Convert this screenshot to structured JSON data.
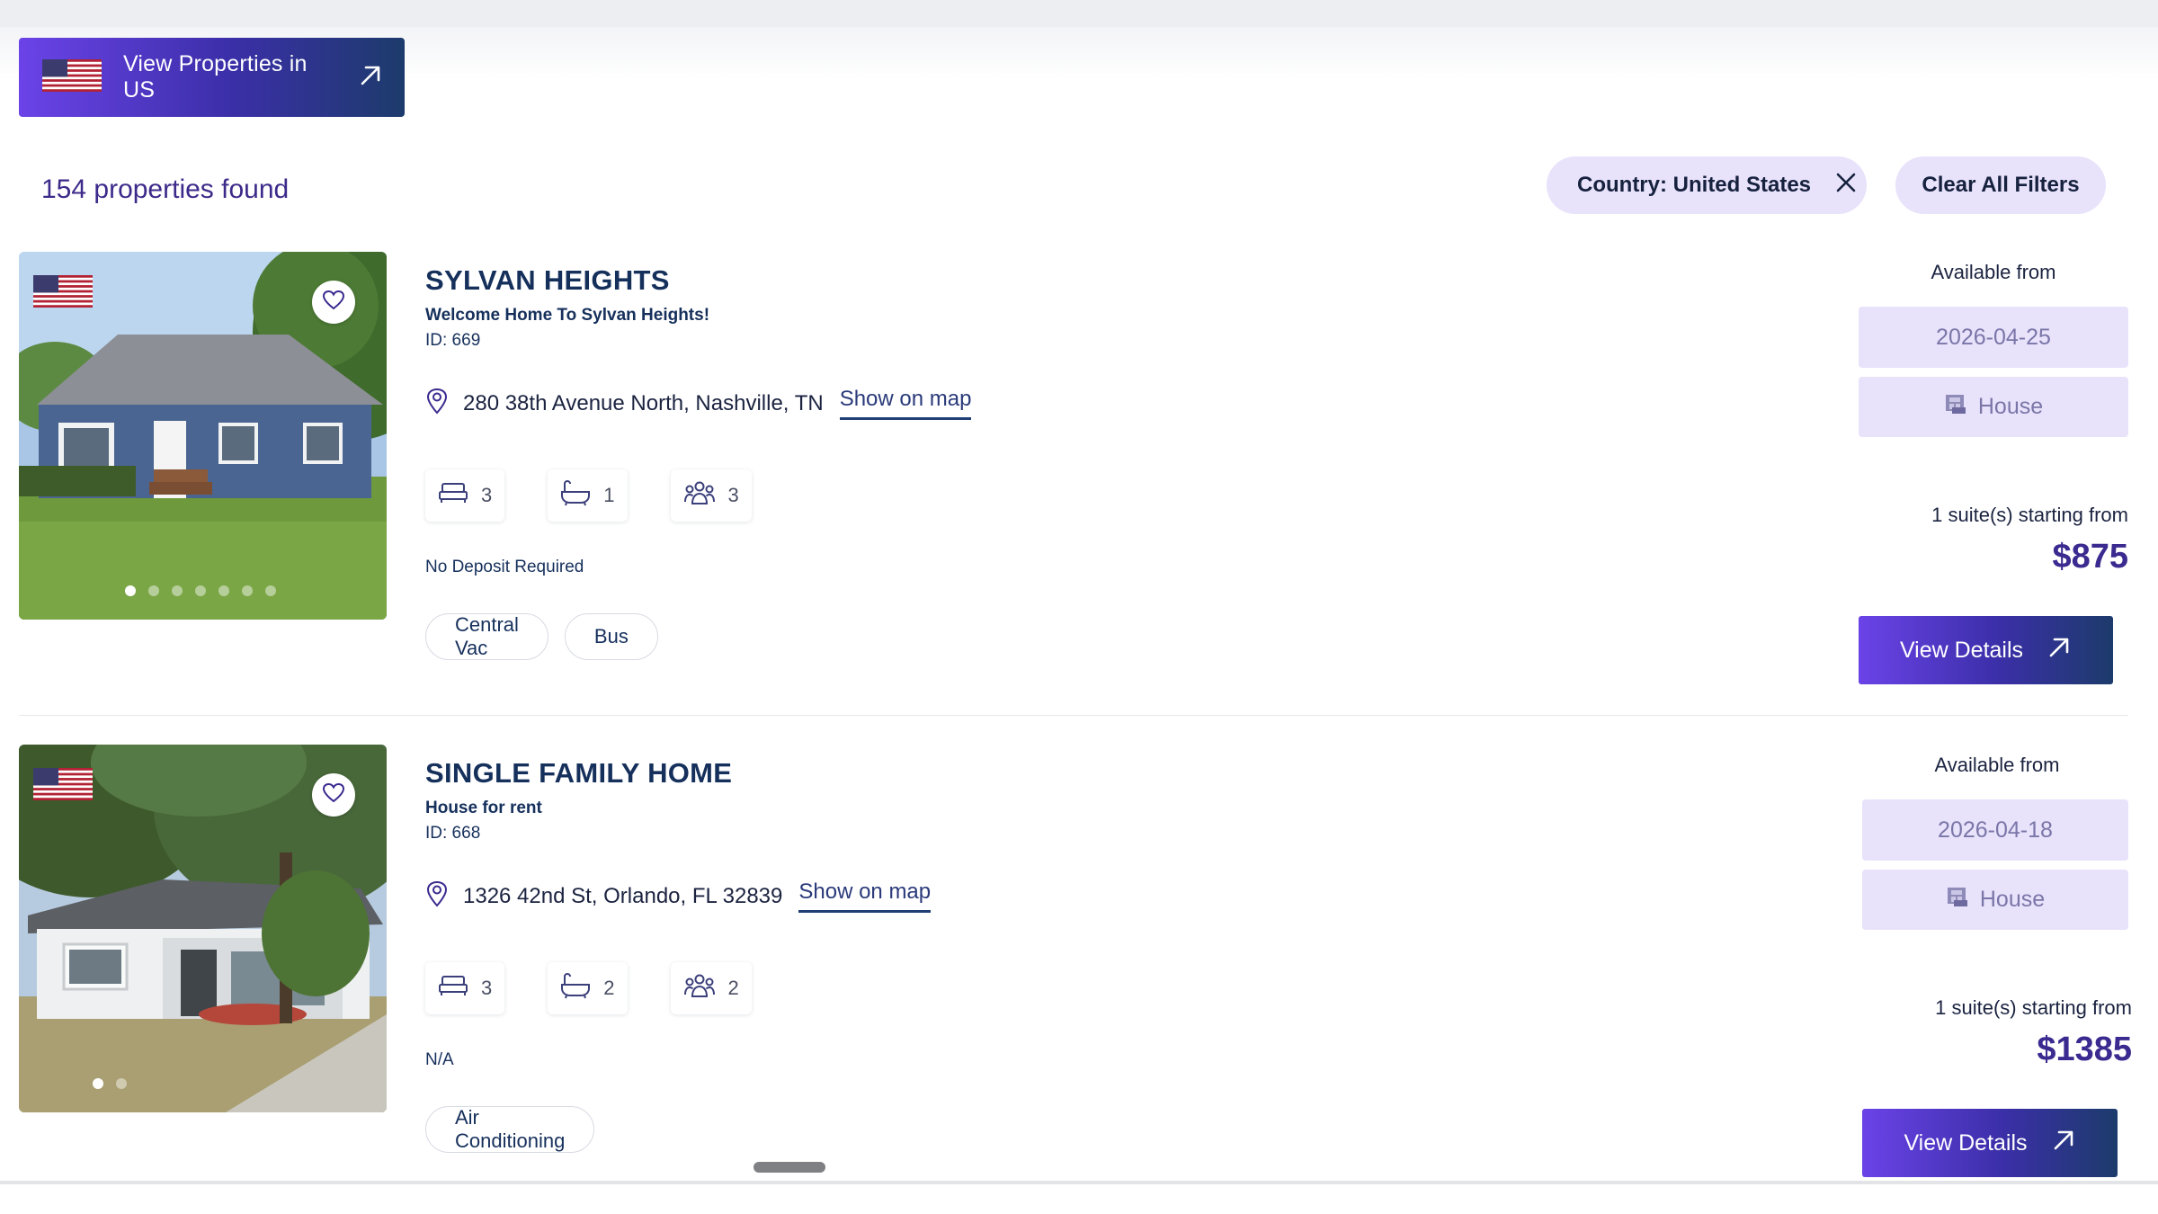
{
  "header": {
    "view_us_label": "View Properties in US"
  },
  "results": {
    "count_text": "154 properties found"
  },
  "filters": {
    "country_chip": "Country: United States",
    "clear_all": "Clear All Filters"
  },
  "listings": [
    {
      "title": "SYLVAN HEIGHTS",
      "subtitle": "Welcome Home To Sylvan Heights!",
      "id_text": "ID: 669",
      "address": "280 38th Avenue North, Nashville, TN",
      "show_on_map": "Show on map",
      "beds": "3",
      "baths": "1",
      "occupants": "3",
      "note": "No Deposit Required",
      "tags": [
        "Central Vac",
        "Bus"
      ],
      "available_label": "Available from",
      "available_date": "2026-04-25",
      "type": "House",
      "suites_text": "1 suite(s) starting from",
      "price": "$875",
      "details_label": "View Details",
      "photo_dots": 7,
      "active_dot": 0
    },
    {
      "title": "SINGLE FAMILY HOME",
      "subtitle": "House for rent",
      "id_text": "ID: 668",
      "address": "1326 42nd St, Orlando, FL 32839",
      "show_on_map": "Show on map",
      "beds": "3",
      "baths": "2",
      "occupants": "2",
      "note": "N/A",
      "tags": [
        "Air Conditioning"
      ],
      "available_label": "Available from",
      "available_date": "2026-04-18",
      "type": "House",
      "suites_text": "1 suite(s) starting from",
      "price": "$1385",
      "details_label": "View Details",
      "photo_dots": 2,
      "active_dot": 0
    }
  ],
  "colors": {
    "accent_gradient_start": "#6b43e8",
    "accent_gradient_end": "#1c3b6b",
    "chip_bg": "#e8e2fb",
    "title_navy": "#16305c",
    "price_purple": "#3b2a8f"
  },
  "icons": {
    "flag": "us-flag-icon",
    "external": "arrow-up-right-icon",
    "close": "close-icon",
    "favorite": "heart-icon",
    "location": "map-pin-icon",
    "bed": "bed-icon",
    "bath": "bathtub-icon",
    "people": "people-icon",
    "house": "house-icon"
  }
}
